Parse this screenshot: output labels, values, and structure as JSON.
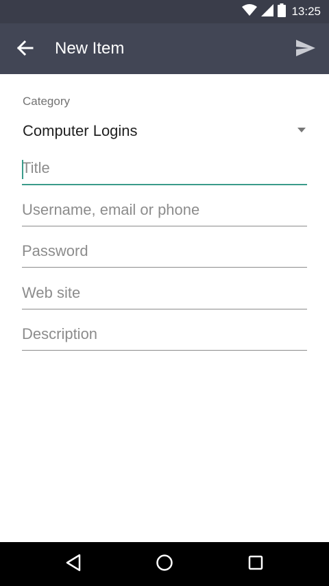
{
  "status_bar": {
    "time": "13:25",
    "icons": [
      "wifi-icon",
      "signal-icon",
      "battery-icon"
    ]
  },
  "app_bar": {
    "title": "New Item",
    "back_icon": "arrow-left-icon",
    "send_icon": "send-icon"
  },
  "form": {
    "category_label": "Category",
    "category_value": "Computer Logins",
    "fields": [
      {
        "name": "title",
        "placeholder": "Title",
        "value": "",
        "focused": true
      },
      {
        "name": "username",
        "placeholder": "Username, email or phone",
        "value": ""
      },
      {
        "name": "password",
        "placeholder": "Password",
        "value": ""
      },
      {
        "name": "website",
        "placeholder": "Web site",
        "value": ""
      },
      {
        "name": "description",
        "placeholder": "Description",
        "value": ""
      }
    ]
  },
  "nav_bar": {
    "buttons": [
      "back-triangle-icon",
      "home-circle-icon",
      "recents-square-icon"
    ]
  },
  "colors": {
    "app_bar": "#424655",
    "status_bar": "#3a3d4a",
    "accent": "#3a9b8a"
  }
}
